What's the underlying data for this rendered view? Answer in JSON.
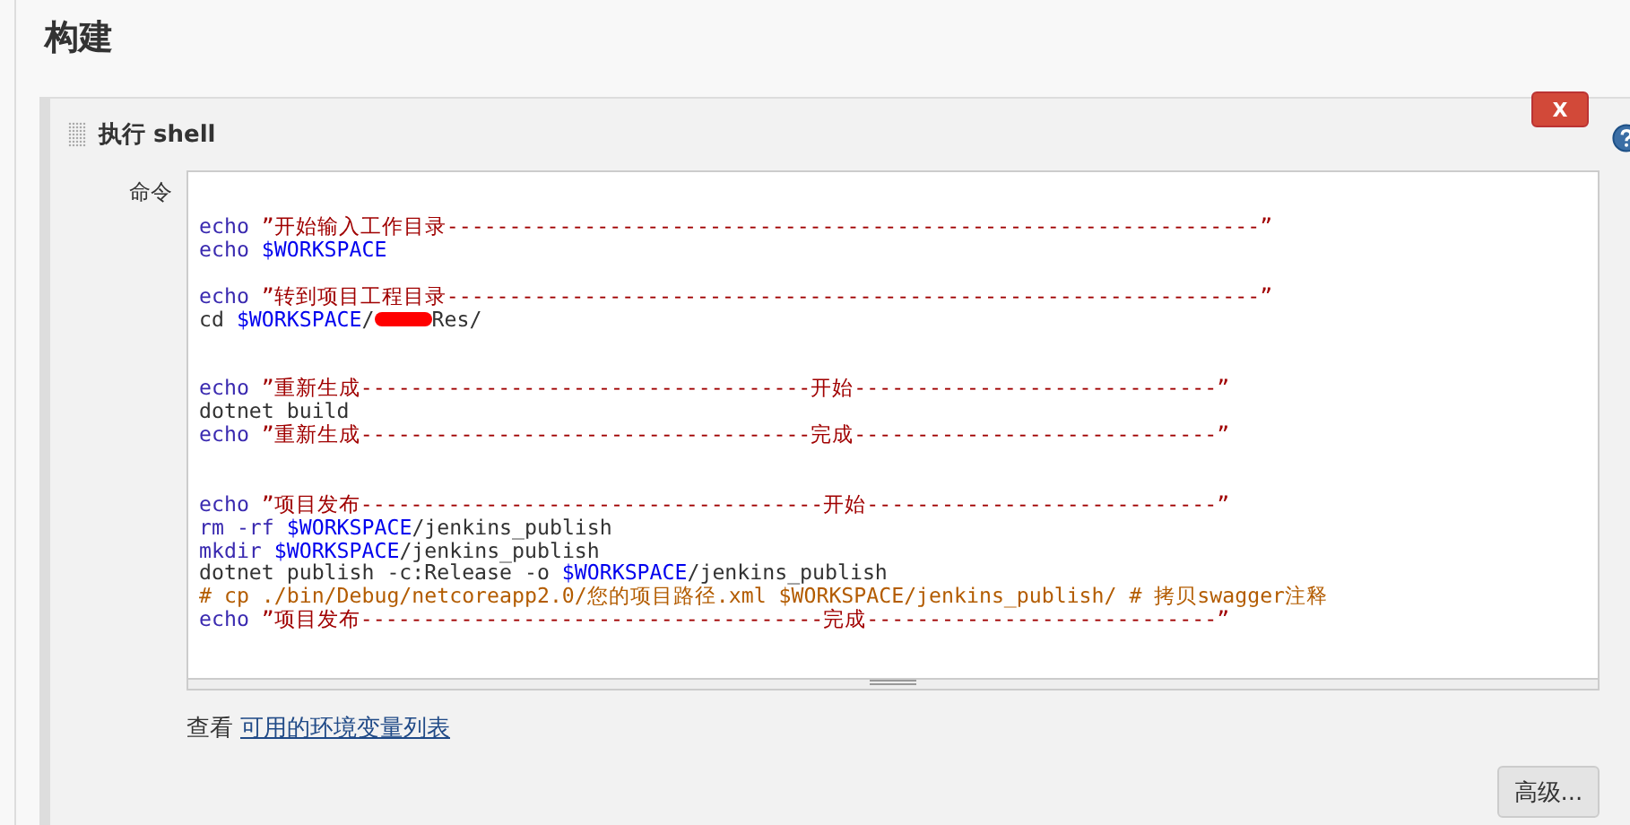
{
  "page_title": "构建",
  "step": {
    "title": "执行 shell",
    "delete_button": "X",
    "field_label": "命令",
    "command_lines": [
      {
        "kind": "blank"
      },
      {
        "kind": "code",
        "tokens": [
          {
            "kind": "keyword",
            "text": "echo "
          },
          {
            "kind": "string",
            "text": "”开始输入工作目录-----------------------------------------------------------------”"
          }
        ]
      },
      {
        "kind": "code",
        "tokens": [
          {
            "kind": "keyword",
            "text": "echo "
          },
          {
            "kind": "variable",
            "text": "$WORKSPACE"
          }
        ]
      },
      {
        "kind": "blank"
      },
      {
        "kind": "code",
        "tokens": [
          {
            "kind": "keyword",
            "text": "echo "
          },
          {
            "kind": "string",
            "text": "”转到项目工程目录-----------------------------------------------------------------”"
          }
        ]
      },
      {
        "kind": "code",
        "tokens": [
          {
            "kind": "plain",
            "text": "cd "
          },
          {
            "kind": "variable",
            "text": "$WORKSPACE"
          },
          {
            "kind": "plain",
            "text": "/"
          },
          {
            "kind": "redacted"
          },
          {
            "kind": "plain",
            "text": "Res/"
          }
        ]
      },
      {
        "kind": "blank"
      },
      {
        "kind": "blank"
      },
      {
        "kind": "code",
        "tokens": [
          {
            "kind": "keyword",
            "text": "echo "
          },
          {
            "kind": "string",
            "text": "”重新生成------------------------------------开始-----------------------------”"
          }
        ]
      },
      {
        "kind": "code",
        "tokens": [
          {
            "kind": "plain",
            "text": "dotnet build"
          }
        ]
      },
      {
        "kind": "code",
        "tokens": [
          {
            "kind": "keyword",
            "text": "echo "
          },
          {
            "kind": "string",
            "text": "”重新生成------------------------------------完成-----------------------------”"
          }
        ]
      },
      {
        "kind": "blank"
      },
      {
        "kind": "blank"
      },
      {
        "kind": "code",
        "tokens": [
          {
            "kind": "keyword",
            "text": "echo "
          },
          {
            "kind": "string",
            "text": "”项目发布-------------------------------------开始----------------------------”"
          }
        ]
      },
      {
        "kind": "code",
        "tokens": [
          {
            "kind": "keyword",
            "text": "rm -rf "
          },
          {
            "kind": "variable",
            "text": "$WORKSPACE"
          },
          {
            "kind": "plain",
            "text": "/jenkins_publish"
          }
        ]
      },
      {
        "kind": "code",
        "tokens": [
          {
            "kind": "keyword",
            "text": "mkdir "
          },
          {
            "kind": "variable",
            "text": "$WORKSPACE"
          },
          {
            "kind": "plain",
            "text": "/jenkins_publish"
          }
        ]
      },
      {
        "kind": "code",
        "tokens": [
          {
            "kind": "plain",
            "text": "dotnet publish -c:Release -o "
          },
          {
            "kind": "variable",
            "text": "$WORKSPACE"
          },
          {
            "kind": "plain",
            "text": "/jenkins_publish"
          }
        ]
      },
      {
        "kind": "code",
        "tokens": [
          {
            "kind": "comment",
            "text": "# cp ./bin/Debug/netcoreapp2.0/您的项目路径.xml $WORKSPACE/jenkins_publish/ # 拷贝swagger注释"
          }
        ]
      },
      {
        "kind": "code",
        "tokens": [
          {
            "kind": "keyword",
            "text": "echo "
          },
          {
            "kind": "string",
            "text": "”项目发布-------------------------------------完成----------------------------”"
          }
        ]
      }
    ],
    "help_text": "查看",
    "help_link": "可用的环境变量列表",
    "advanced_button": "高级..."
  }
}
